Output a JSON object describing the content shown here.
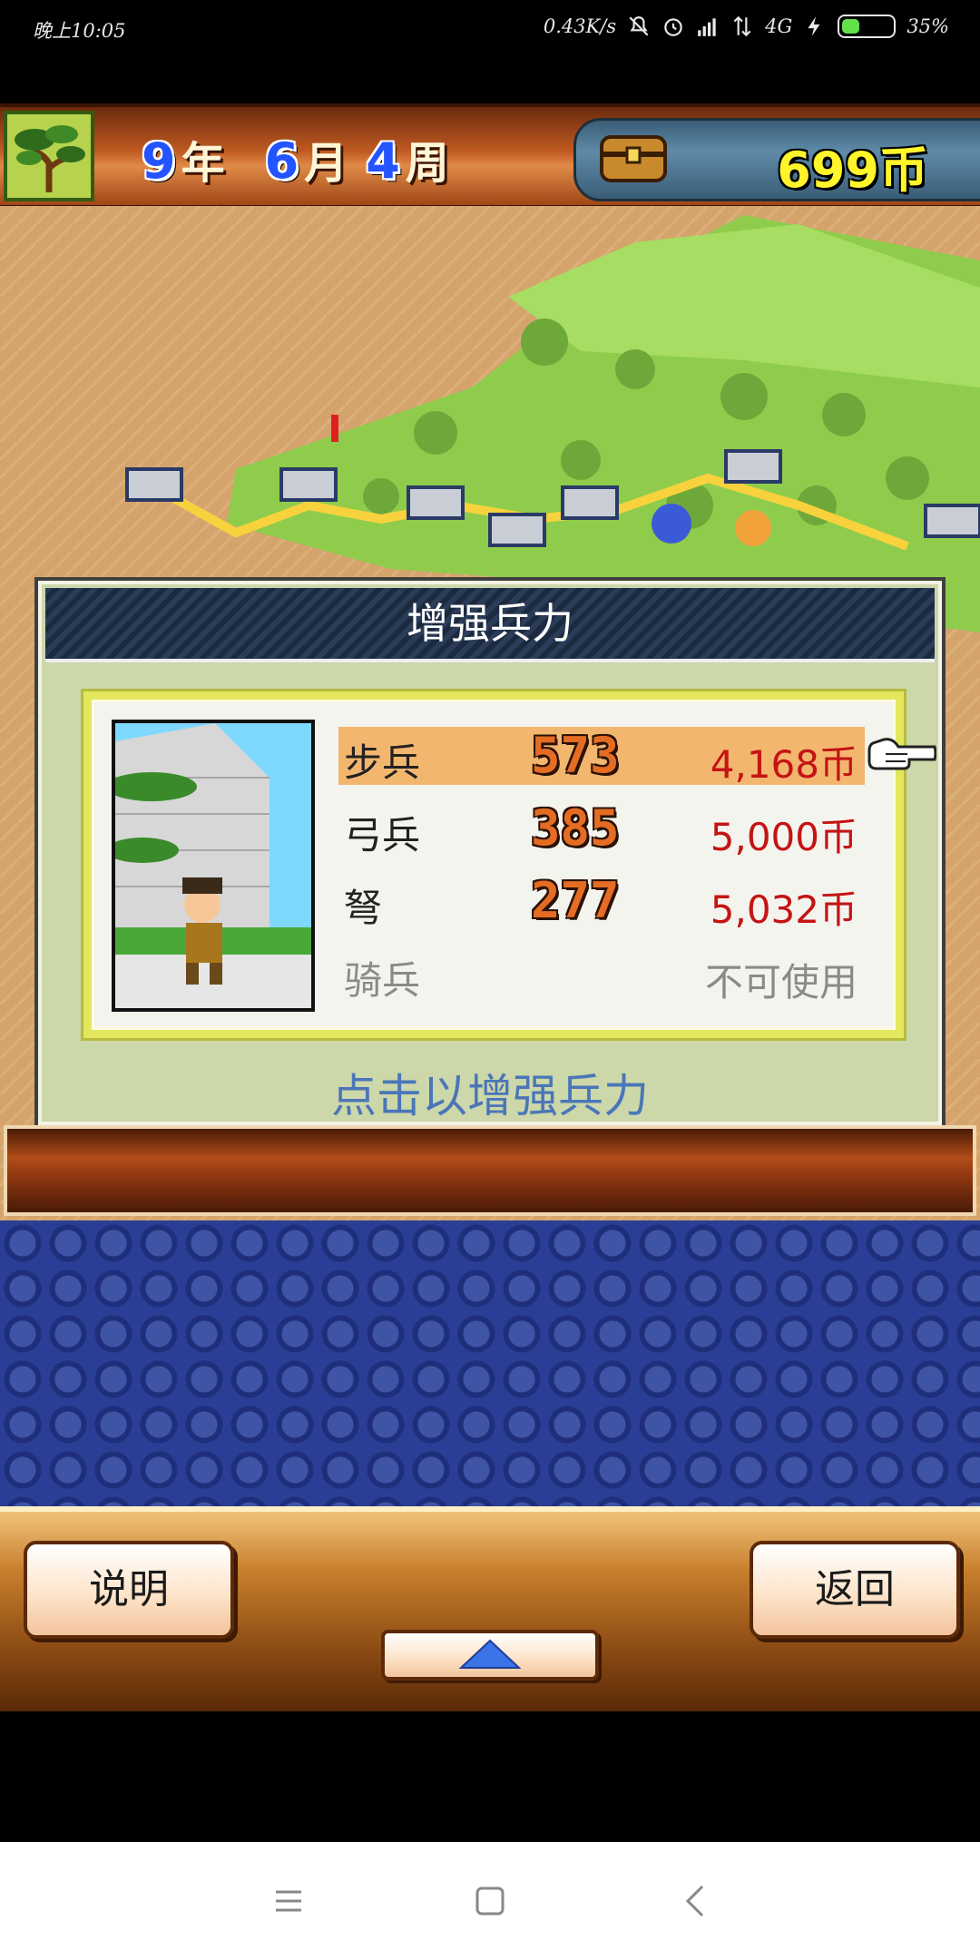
{
  "status_bar": {
    "time": "晚上10:05",
    "network_speed": "0.43K/s",
    "network_type": "4G",
    "battery_percent": "35%",
    "battery_level": 0.35,
    "icons": [
      "mute-icon",
      "alarm-icon",
      "signal-icon",
      "data-arrows-icon",
      "charging-icon",
      "battery-icon"
    ]
  },
  "hud": {
    "year_value": "9",
    "year_unit": "年",
    "month_value": "6",
    "month_unit": "月",
    "week_value": "4",
    "week_unit": "周",
    "money": "699币",
    "icons": [
      "bonsai-tree-icon",
      "treasure-chest-icon"
    ]
  },
  "dialog": {
    "title": "增强兵力",
    "hint": "点击以增强兵力",
    "units": [
      {
        "label": "步兵",
        "count": "573",
        "price": "4,168币",
        "selected": true
      },
      {
        "label": "弓兵",
        "count": "385",
        "price": "5,000币",
        "selected": false
      },
      {
        "label": "弩",
        "count": "277",
        "price": "5,032币",
        "selected": false
      },
      {
        "label": "骑兵",
        "count": "",
        "price": "不可使用",
        "selected": false,
        "disabled": true
      }
    ]
  },
  "buttons": {
    "help": "说明",
    "back": "返回",
    "scroll_up_icon": "up-triangle-icon"
  },
  "colors": {
    "accent_blue": "#2454ff",
    "money_yellow": "#fff52a",
    "price_red": "#c41414",
    "hint_blue": "#4a76b8",
    "selected_row": "#f3b66f"
  }
}
